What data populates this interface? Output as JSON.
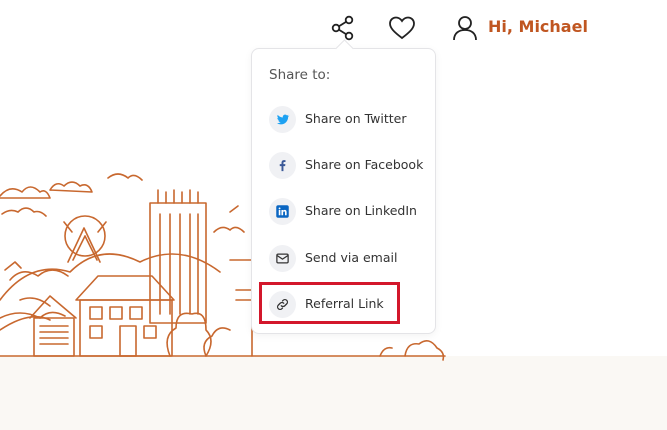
{
  "header": {
    "greeting": "Hi, Michael",
    "icons": [
      "share-icon",
      "heart-icon",
      "user-icon"
    ]
  },
  "share_menu": {
    "title": "Share to:",
    "items": [
      {
        "label": "Share on Twitter",
        "icon": "twitter-icon"
      },
      {
        "label": "Share on Facebook",
        "icon": "facebook-icon"
      },
      {
        "label": "Share on LinkedIn",
        "icon": "linkedin-icon"
      },
      {
        "label": "Send via email",
        "icon": "email-icon"
      },
      {
        "label": "Referral Link",
        "icon": "link-icon"
      }
    ]
  },
  "colors": {
    "accent": "#c05621",
    "illustration": "#c8682f",
    "highlight": "#d3172b",
    "twitter": "#1da1f2",
    "facebook": "#3b5998",
    "linkedin": "#0a66c2"
  }
}
